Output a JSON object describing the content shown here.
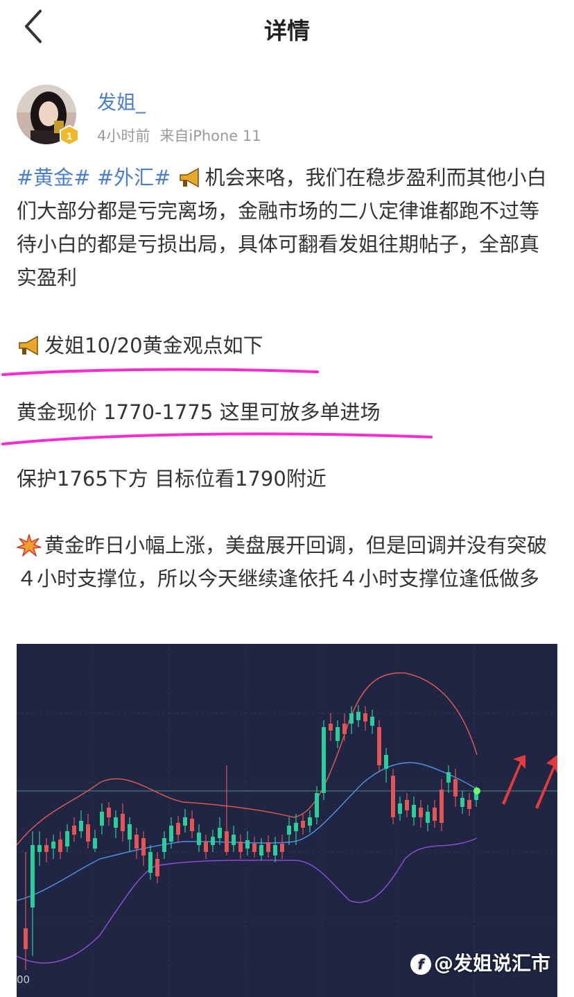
{
  "nav": {
    "title": "详情"
  },
  "author": {
    "name": "发姐_",
    "time": "4小时前",
    "source": "来自iPhone 11",
    "badge_level": "1"
  },
  "post": {
    "topic_gold": "#黄金#",
    "topic_forex": "#外汇#",
    "para1_text": "机会来咯，我们在稳步盈利而其他小白们大部分都是亏完离场，金融市场的二八定律谁都跑不过等待小白的都是亏损出局，具体可翻看发姐往期帖子，全部真实盈利",
    "para2_text": "发姐10/20黄金观点如下",
    "para3_text": "黄金现价 1770-1775 这里可放多单进场",
    "para4_text": "保护1765下方  目标位看1790附近",
    "para5_text": "黄金昨日小幅上涨，美盘展开回调，但是回调并没有突破４小时支撑位，所以今天继续逢依托４小时支撑位逢低做多"
  },
  "image": {
    "watermark": "@发姐说汇市",
    "axis_fragment": "00",
    "colors": {
      "background": "#1f2542",
      "bull": "#2ecc9a",
      "bear": "#e05555",
      "upper_band": "#d9594f",
      "middle_band": "#4d8fe0",
      "lower_band": "#8a4fd1",
      "arrow": "#e23b3b"
    }
  },
  "highlight_color": "#ff2bd1",
  "link_color": "#4a7ecf"
}
